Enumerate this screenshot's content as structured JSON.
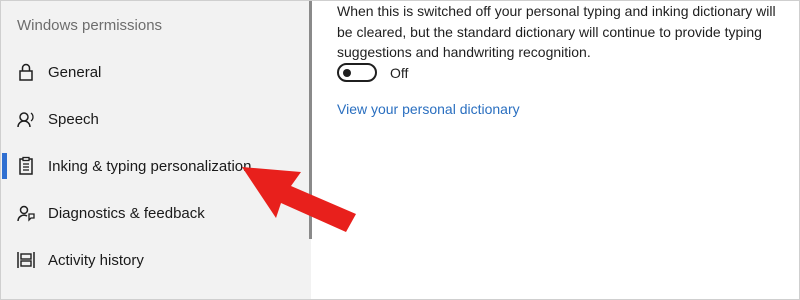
{
  "sidebar": {
    "section_title": "Windows permissions",
    "items": [
      {
        "label": "General",
        "icon": "lock-icon"
      },
      {
        "label": "Speech",
        "icon": "speech-icon"
      },
      {
        "label": "Inking & typing personalization",
        "icon": "clipboard-list-icon",
        "selected": true
      },
      {
        "label": "Diagnostics & feedback",
        "icon": "person-feedback-icon"
      },
      {
        "label": "Activity history",
        "icon": "timeline-icon"
      }
    ]
  },
  "main": {
    "description": "When this is switched off your personal typing and inking dictionary will be cleared, but the standard dictionary will continue to provide typing suggestions and handwriting recognition.",
    "toggle": {
      "state_label": "Off",
      "on": false
    },
    "link_label": "View your personal dictionary"
  },
  "colors": {
    "accent": "#2f6fd1",
    "link": "#2a6fc0",
    "annotation_arrow": "#e8201c"
  }
}
